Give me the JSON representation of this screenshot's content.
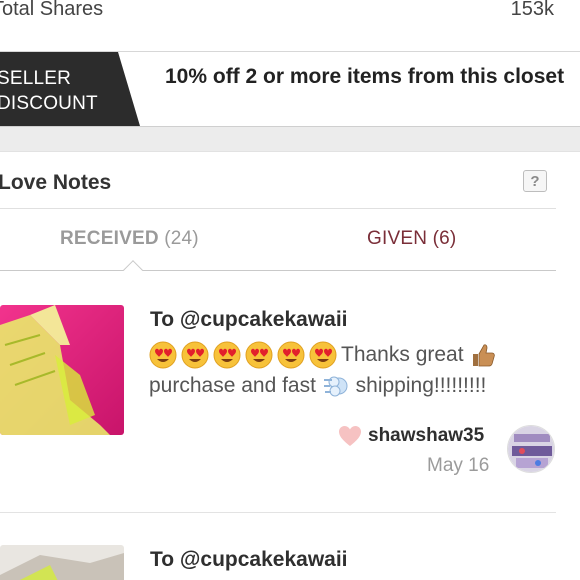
{
  "stats": {
    "label": "Total Shares",
    "value": "153k"
  },
  "discount": {
    "tag_line1": "SELLER",
    "tag_line2": "DISCOUNT",
    "text": "10% off 2 or more items from this closet"
  },
  "love_notes": {
    "title": "Love Notes",
    "help_label": "?",
    "tabs": {
      "received_label": "RECEIVED",
      "received_count": "(24)",
      "given_label": "GIVEN (6)"
    },
    "notes": [
      {
        "to": "To @cupcakekawaii",
        "message_part1": "Thanks great",
        "message_part2": "purchase and fast",
        "message_part3": "shipping!!!!!!!!!",
        "author": "shawshaw35",
        "date": "May 16"
      },
      {
        "to": "To @cupcakekawaii"
      }
    ]
  },
  "colors": {
    "given_tab": "#7a2e38",
    "tag_bg": "#2c2c2c",
    "heart": "#f6c2c2"
  }
}
